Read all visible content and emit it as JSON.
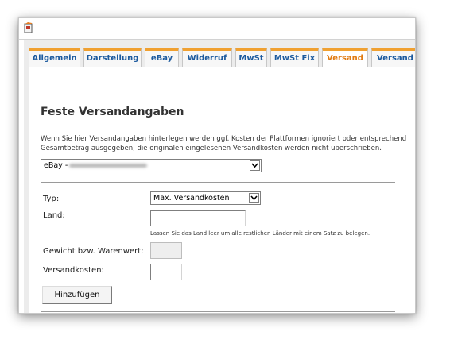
{
  "tabs": [
    {
      "label": "Allgemein",
      "active": false
    },
    {
      "label": "Darstellung",
      "active": false
    },
    {
      "label": "eBay",
      "active": false
    },
    {
      "label": "Widerruf",
      "active": false
    },
    {
      "label": "MwSt",
      "active": false
    },
    {
      "label": "MwSt Fix",
      "active": false
    },
    {
      "label": "Versand",
      "active": true
    },
    {
      "label": "Versand",
      "active": false
    }
  ],
  "section": {
    "title": "Feste Versandangaben",
    "info_line1": "Wenn Sie hier Versandangaben hinterlegen werden ggf. Kosten der Plattformen ignoriert oder entsprechend",
    "info_line2": "Gesamtbetrag ausgegeben, die originalen eingelesenen Versandkosten werden nicht überschrieben."
  },
  "platform_select": {
    "value": "eBay -"
  },
  "form": {
    "typ_label": "Typ:",
    "typ_value": "Max. Versandkosten",
    "land_label": "Land:",
    "land_value": "",
    "land_hint": "Lassen Sie das Land leer um alle restlichen Länder mit einem Satz zu belegen.",
    "gewicht_label": "Gewicht bzw. Warenwert:",
    "gewicht_value": "",
    "versandkosten_label": "Versandkosten:",
    "versandkosten_value": "",
    "add_button": "Hinzufügen"
  },
  "colors": {
    "tab_accent": "#f0a030",
    "tab_text": "#1c5a9e",
    "active_tab_text": "#e07b12",
    "panel_background": "#ececec"
  }
}
